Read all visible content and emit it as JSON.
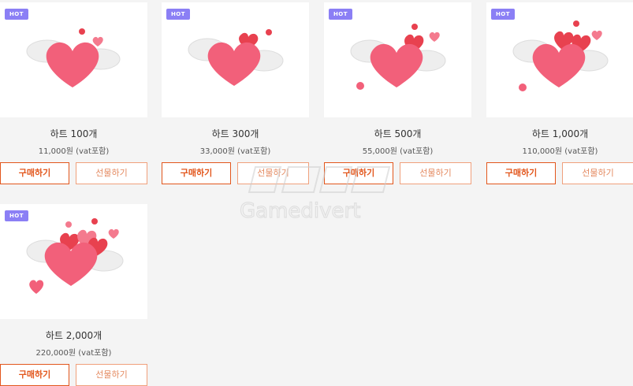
{
  "products": [
    {
      "badge": "HOT",
      "title": "하트 100개",
      "price": "11,000원 (vat포함)",
      "buy_label": "구매하기",
      "gift_label": "선물하기"
    },
    {
      "badge": "HOT",
      "title": "하트 300개",
      "price": "33,000원 (vat포함)",
      "buy_label": "구매하기",
      "gift_label": "선물하기"
    },
    {
      "badge": "HOT",
      "title": "하트 500개",
      "price": "55,000원 (vat포함)",
      "buy_label": "구매하기",
      "gift_label": "선물하기"
    },
    {
      "badge": "HOT",
      "title": "하트 1,000개",
      "price": "110,000원 (vat포함)",
      "buy_label": "구매하기",
      "gift_label": "선물하기"
    },
    {
      "badge": "HOT",
      "title": "하트 2,000개",
      "price": "220,000원 (vat포함)",
      "buy_label": "구매하기",
      "gift_label": "선물하기"
    }
  ],
  "watermark": {
    "text": "Gamedivert"
  },
  "colors": {
    "badge": "#8b7ff5",
    "buy_border": "#e2561c",
    "gift_border": "#f0a07c",
    "heart": "#f2607a",
    "background": "#f4f4f4"
  },
  "icons": {
    "product_image": "winged-heart-icon"
  }
}
